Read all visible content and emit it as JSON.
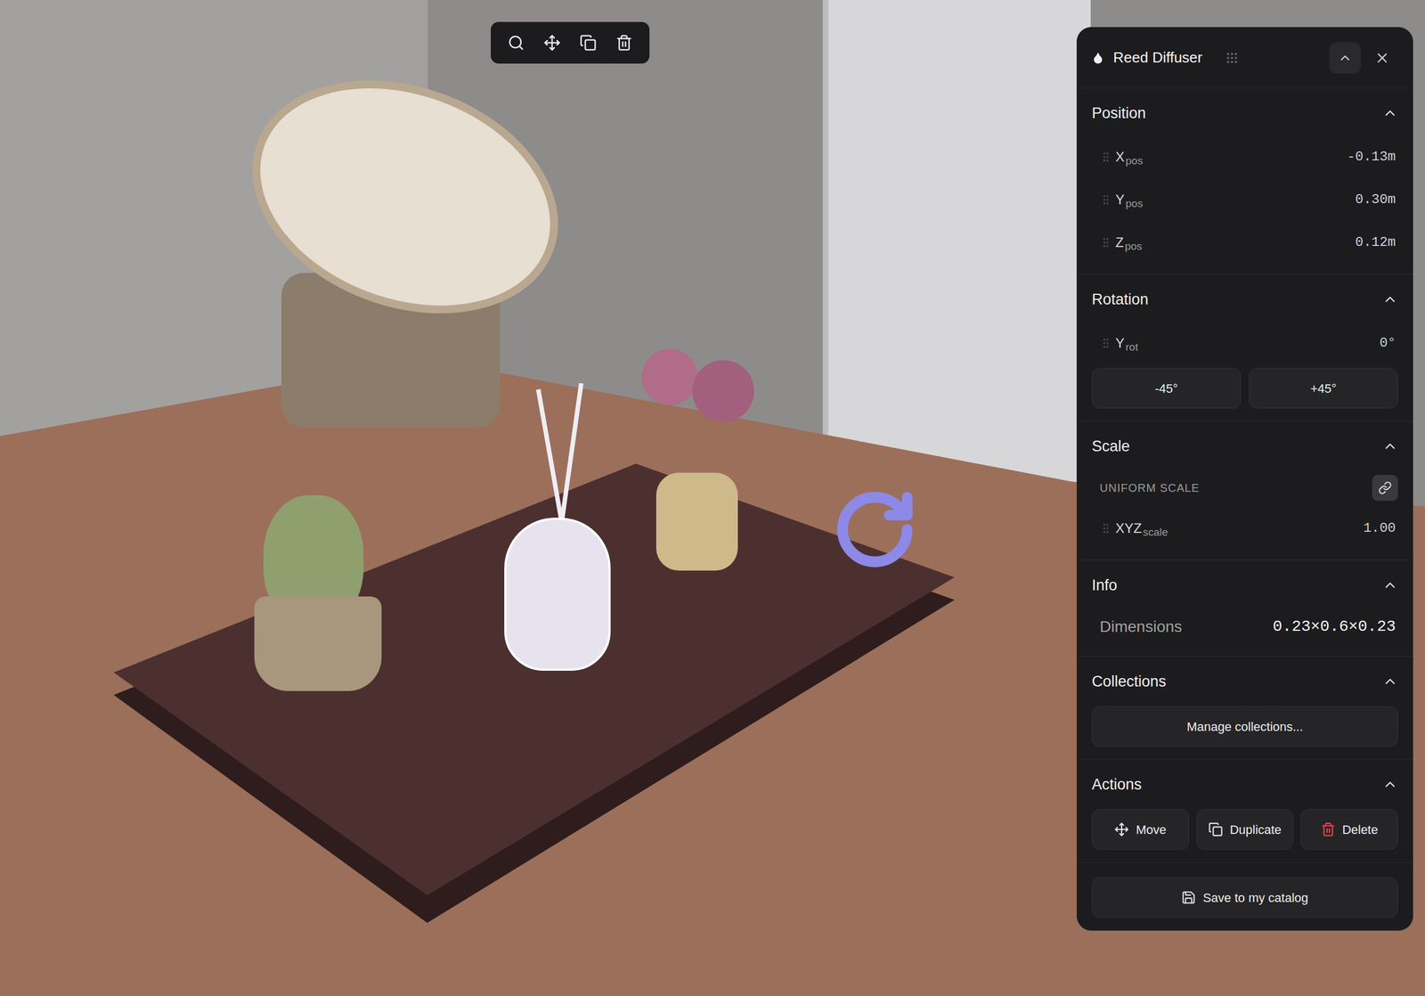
{
  "toolbar": {
    "tools": [
      {
        "kind": "zoom"
      },
      {
        "kind": "move"
      },
      {
        "kind": "duplicate"
      },
      {
        "kind": "delete"
      }
    ]
  },
  "panel": {
    "title": "Reed Diffuser",
    "sections": [
      {
        "kind": "position",
        "title": "Position",
        "expanded": true,
        "rows": [
          {
            "label": "X",
            "sub": "pos",
            "value": "-0.13m"
          },
          {
            "label": "Y",
            "sub": "pos",
            "value": "0.30m"
          },
          {
            "label": "Z",
            "sub": "pos",
            "value": "0.12m"
          }
        ]
      },
      {
        "kind": "rotation",
        "title": "Rotation",
        "expanded": true,
        "rows": [
          {
            "label": "Y",
            "sub": "rot",
            "value": "0°"
          }
        ],
        "buttons": [
          "-45°",
          "+45°"
        ]
      },
      {
        "kind": "scale",
        "title": "Scale",
        "expanded": true,
        "uniform": {
          "label": "UNIFORM SCALE",
          "linked": true
        },
        "rows": [
          {
            "label": "XYZ",
            "sub": "scale",
            "value": "1.00"
          }
        ]
      },
      {
        "kind": "info",
        "title": "Info",
        "expanded": true,
        "fields": [
          {
            "label": "Dimensions",
            "value": "0.23×0.6×0.23"
          }
        ]
      },
      {
        "kind": "collections",
        "title": "Collections",
        "expanded": true,
        "button": "Manage collections..."
      },
      {
        "kind": "actions",
        "title": "Actions",
        "expanded": true,
        "buttons": [
          {
            "kind": "move",
            "label": "Move"
          },
          {
            "kind": "duplicate",
            "label": "Duplicate"
          },
          {
            "kind": "delete",
            "label": "Delete"
          }
        ]
      }
    ],
    "footer_button": "Save to my catalog"
  }
}
